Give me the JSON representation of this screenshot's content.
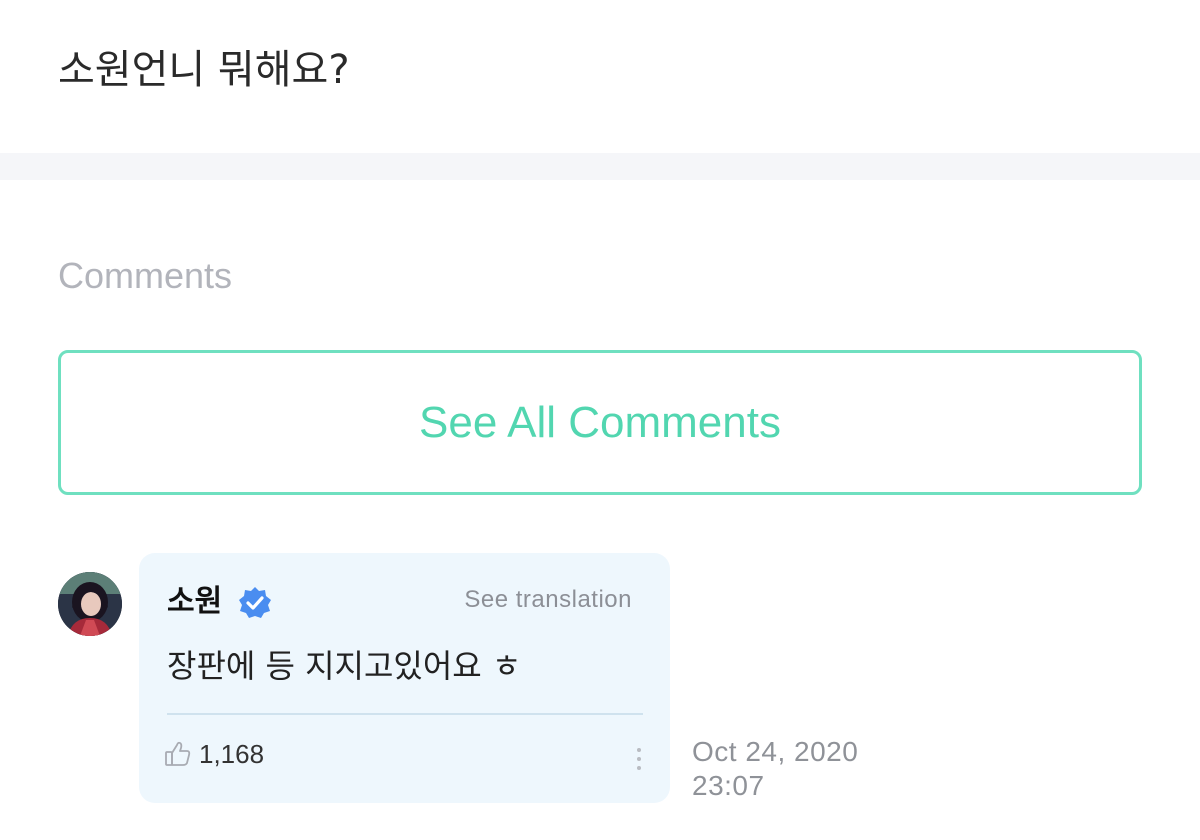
{
  "post": {
    "title": "소원언니 뭐해요?"
  },
  "comments_section": {
    "heading": "Comments",
    "see_all_label": "See All Comments"
  },
  "comment": {
    "author": "소원",
    "see_translation_label": "See translation",
    "text": "장판에 등 지지고있어요 ㅎ",
    "likes": "1,168",
    "date": "Oct 24, 2020",
    "time": "23:07",
    "icons": {
      "verified": "verified-badge-icon",
      "like": "thumbs-up-icon",
      "more": "more-vertical-icon"
    }
  },
  "colors": {
    "accent": "#52d6b0",
    "accent_border": "#6fe0c0",
    "verified": "#4a8df0",
    "card_background": "#eef7fd",
    "divider_band": "#f5f6f9"
  }
}
